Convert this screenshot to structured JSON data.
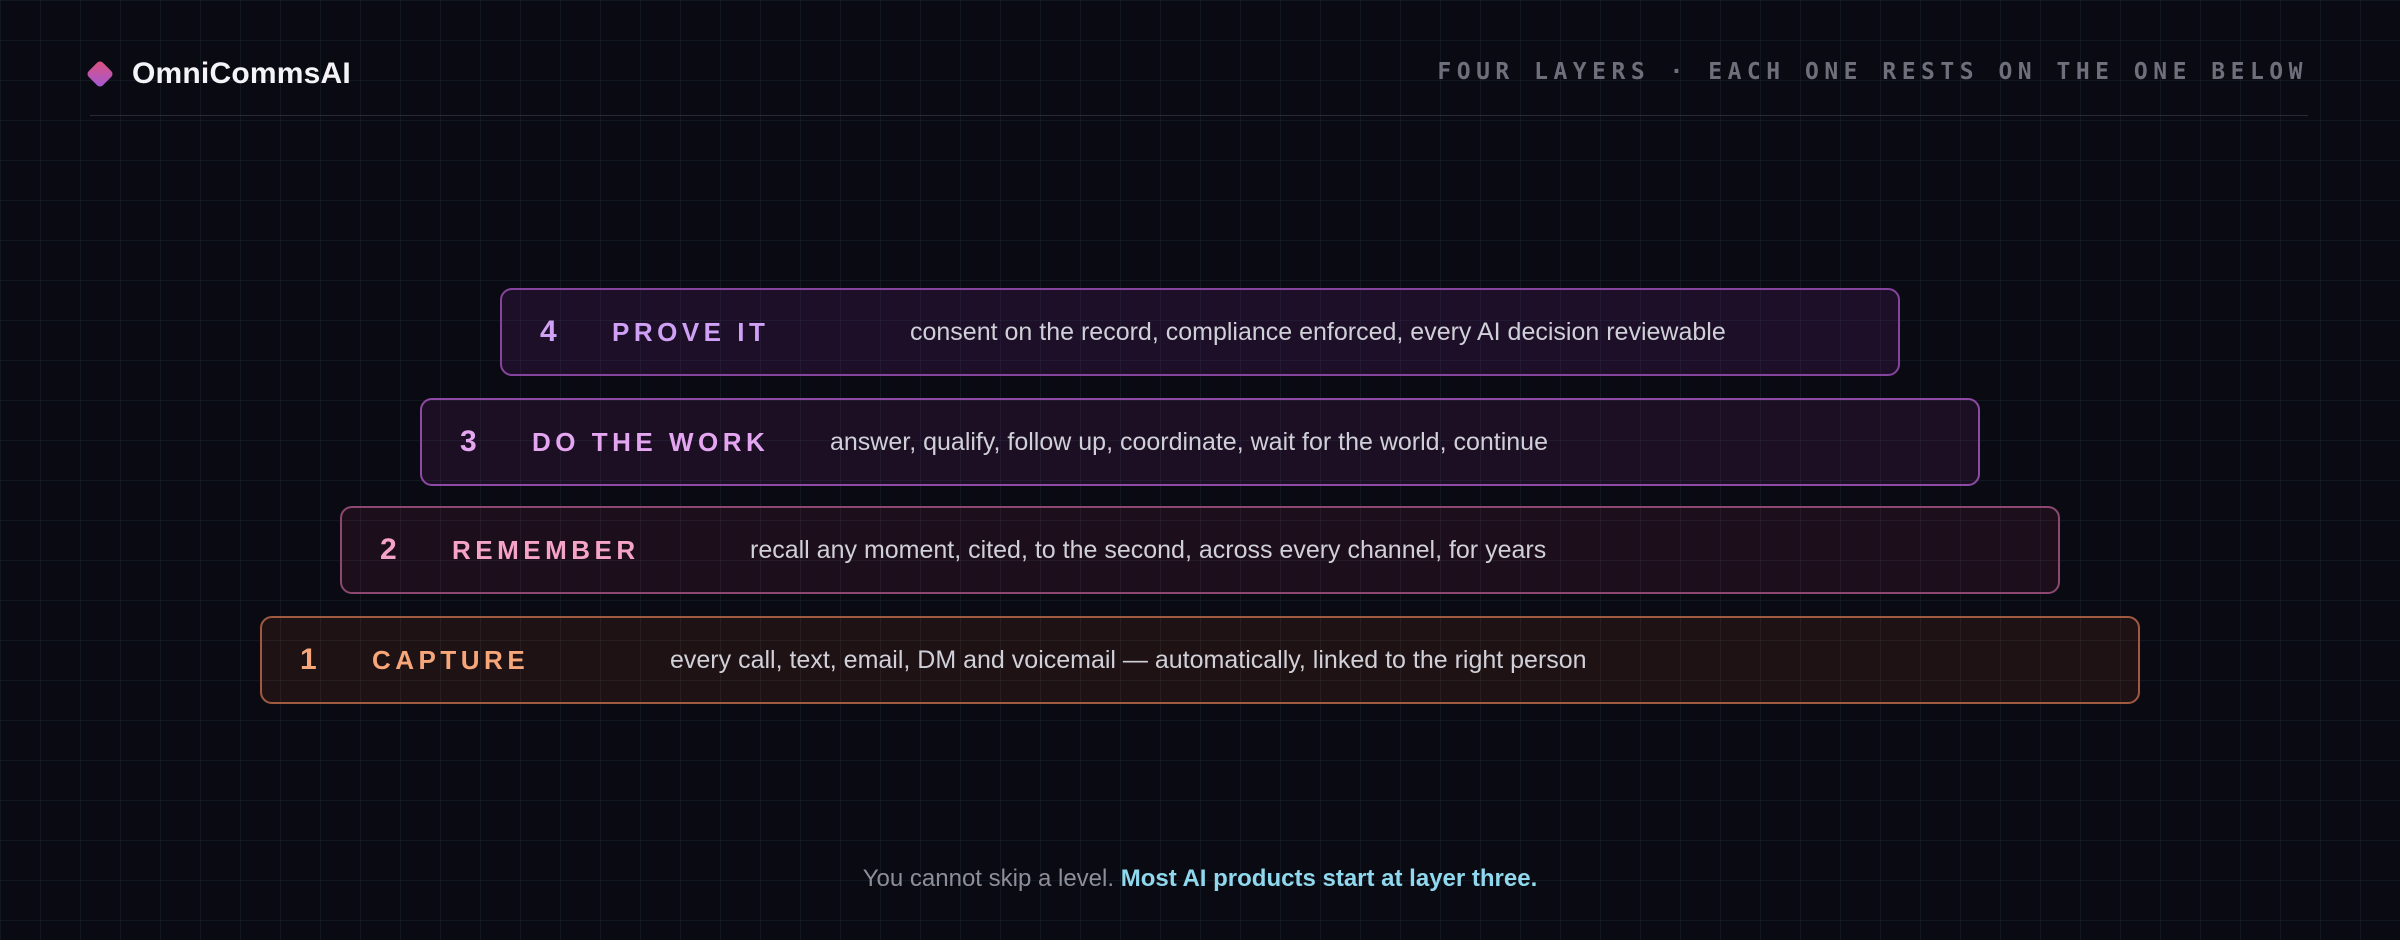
{
  "brand": {
    "name": "OmniCommsAI",
    "icon": "diamond-icon",
    "colors": [
      "#e0507a",
      "#a05ad8"
    ]
  },
  "header": {
    "tagline": "FOUR LAYERS · EACH ONE RESTS ON THE ONE BELOW"
  },
  "layers": [
    {
      "number": "4",
      "name": "PROVE IT",
      "description": "consent on the record, compliance enforced, every AI decision reviewable",
      "color": "#cfa0f4"
    },
    {
      "number": "3",
      "name": "DO THE WORK",
      "description": "answer, qualify, follow up, coordinate, wait for the world, continue",
      "color": "#e4a6f0"
    },
    {
      "number": "2",
      "name": "REMEMBER",
      "description": "recall any moment, cited, to the second, across every channel, for years",
      "color": "#f6a4c6"
    },
    {
      "number": "1",
      "name": "CAPTURE",
      "description": "every call, text, email, DM and voicemail — automatically, linked to the right person",
      "color": "#f6a678"
    }
  ],
  "footer": {
    "muted": "You cannot skip a level.",
    "accent": "Most AI products start at layer three."
  }
}
